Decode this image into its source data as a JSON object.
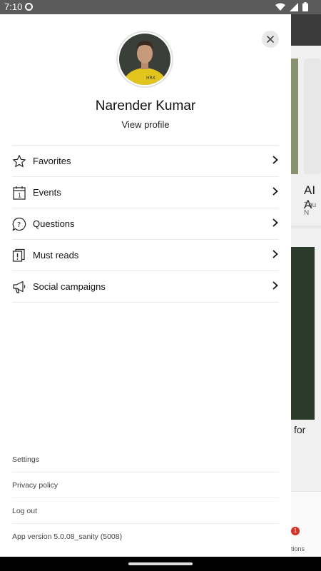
{
  "status_bar": {
    "time": "7:10"
  },
  "background": {
    "title_fragment": "AI A",
    "date_fragment": "Thu N",
    "caption_fragment": "for",
    "badge_count": "1",
    "tab_fragment": "tions"
  },
  "drawer": {
    "profile": {
      "name": "Narender Kumar",
      "view_profile": "View profile",
      "avatar_shirt_text": "HRX"
    },
    "menu": [
      {
        "label": "Favorites",
        "icon": "star-icon"
      },
      {
        "label": "Events",
        "icon": "calendar-icon"
      },
      {
        "label": "Questions",
        "icon": "question-bubble-icon"
      },
      {
        "label": "Must reads",
        "icon": "document-alert-icon"
      },
      {
        "label": "Social campaigns",
        "icon": "megaphone-icon"
      }
    ],
    "footer": {
      "settings": "Settings",
      "privacy": "Privacy policy",
      "logout": "Log out",
      "version": "App version 5.0.08_sanity (5008)"
    }
  }
}
